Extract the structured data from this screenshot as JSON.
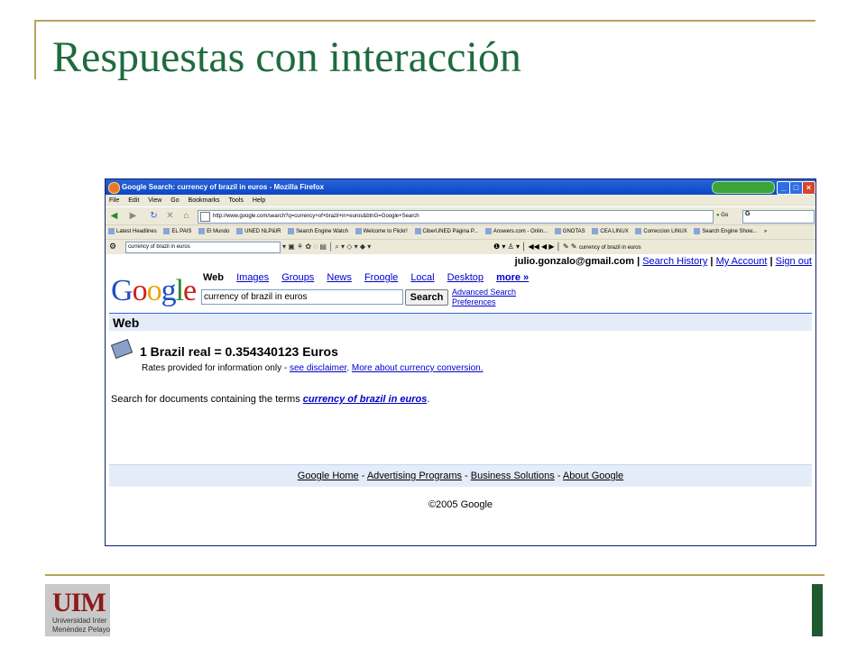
{
  "slide": {
    "title": "Respuestas con interacción",
    "logo_text": "UIM",
    "logo_subtext_1": "Universidad Inter",
    "logo_subtext_2": "Menéndez Pelayo"
  },
  "browser": {
    "window_title": "Google Search: currency of brazil in euros - Mozilla Firefox",
    "menu": [
      "File",
      "Edit",
      "View",
      "Go",
      "Bookmarks",
      "Tools",
      "Help"
    ],
    "url": "http://www.google.com/search?q=currency+of+brazil+in+euros&btnG=Google+Search",
    "go_label": "Go",
    "nav_search_value": "G",
    "bookmarks": [
      "Latest Headlines",
      "EL PAIS",
      "El Mundo",
      "UNED NLP&IR",
      "Search Engine Watch",
      "Welcome to Flickr!",
      "CiberUNED Página P...",
      "Answers.com - Onlin...",
      "GNOTAS",
      "CEA LINUX",
      "Correccion LINUX",
      "Search Engine Show..."
    ],
    "bookmarks_more": "»",
    "toolbar_search_value": "currency of brazil in euros",
    "toolbar_highlight_terms": [
      "currency",
      "of",
      "brazil",
      "in",
      "euros"
    ]
  },
  "google": {
    "account_email": "julio.gonzalo@gmail.com",
    "account_links": [
      "Search History",
      "My Account",
      "Sign out"
    ],
    "logo": "Google",
    "tab_active": "Web",
    "tabs": [
      "Images",
      "Groups",
      "News",
      "Froogle",
      "Local",
      "Desktop"
    ],
    "more": "more »",
    "query": "currency of brazil in euros",
    "search_button": "Search",
    "advanced_search": "Advanced Search",
    "preferences": "Preferences",
    "section": "Web",
    "result_headline": "1 Brazil real = 0.354340123 Euros",
    "rates_note": "Rates provided for information only - ",
    "disclaimer_link": "see disclaimer",
    "more_about_link": "More about currency conversion.",
    "search_for_prefix": "Search for documents containing the terms ",
    "search_for_link": "currency of brazil in euros",
    "search_for_suffix": ".",
    "footer_links": [
      "Google Home",
      "Advertising Programs",
      "Business Solutions",
      "About Google"
    ],
    "footer_separator": " - ",
    "copyright": "©2005 Google"
  },
  "colors": {
    "title_green": "#1e6b3e",
    "frame_gold": "#b8a25a",
    "link_blue": "#0000cc",
    "xp_blue": "#0a47c7"
  }
}
